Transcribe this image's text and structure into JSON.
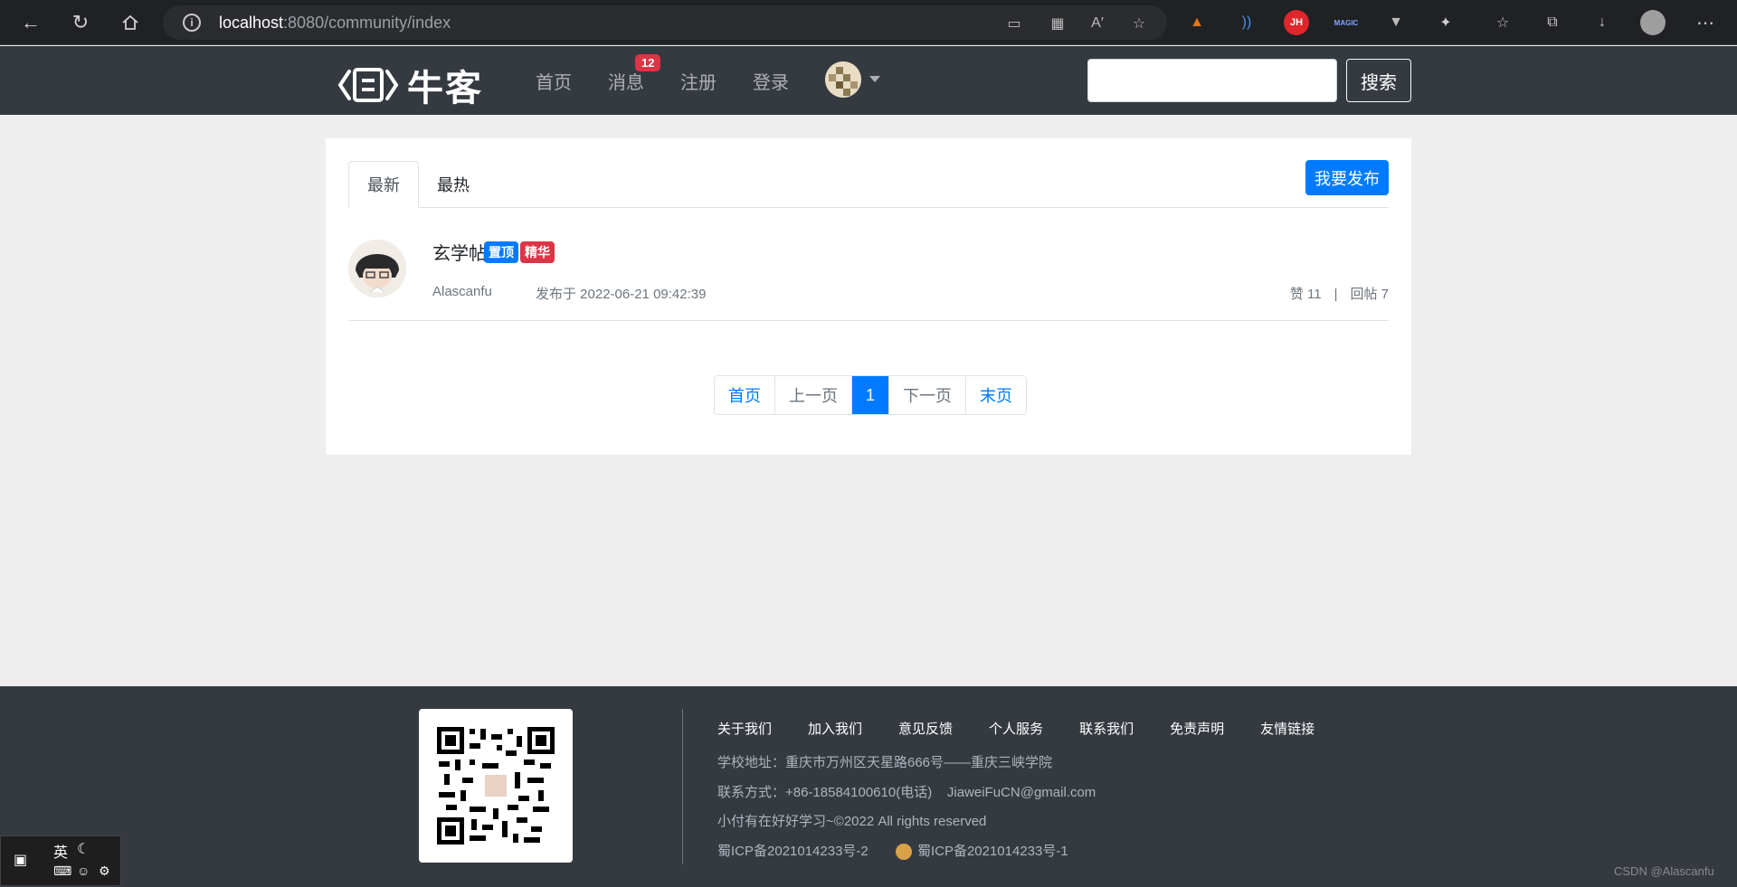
{
  "browser": {
    "url_host": "localhost",
    "url_rest": ":8080/community/index"
  },
  "header": {
    "logo_text": "牛客",
    "nav": [
      {
        "label": "首页"
      },
      {
        "label": "消息"
      },
      {
        "label": "注册"
      },
      {
        "label": "登录"
      }
    ],
    "message_count": "12",
    "search_value": "",
    "search_button": "搜索"
  },
  "main": {
    "tabs": [
      {
        "label": "最新",
        "active": true
      },
      {
        "label": "最热",
        "active": false
      }
    ],
    "publish_button": "我要发布",
    "posts": [
      {
        "title": "玄学帖",
        "tags": [
          "置顶",
          "精华"
        ],
        "author": "Alascanfu",
        "date": "发布于 2022-06-21 09:42:39",
        "likes": "赞 11",
        "sep": "|",
        "replies": "回帖 7"
      }
    ],
    "pagination": [
      "首页",
      "上一页",
      "1",
      "下一页",
      "末页"
    ]
  },
  "footer": {
    "links": [
      "关于我们",
      "加入我们",
      "意见反馈",
      "个人服务",
      "联系我们",
      "免责声明",
      "友情链接"
    ],
    "address": "学校地址：重庆市万州区天星路666号——重庆三峡学院",
    "contact": "联系方式：+86-18584100610(电话)    JiaweiFuCN@gmail.com",
    "copyright": "小付有在好好学习~©2022 All rights reserved",
    "icp1": "蜀ICP备2021014233号-2",
    "icp2": "蜀ICP备2021014233号-1"
  },
  "overlay": {
    "ime_lang": "英",
    "watermark": "CSDN @Alascanfu"
  },
  "colors": {
    "primary": "#007bff",
    "danger": "#dc3545",
    "dark": "#343a40"
  }
}
